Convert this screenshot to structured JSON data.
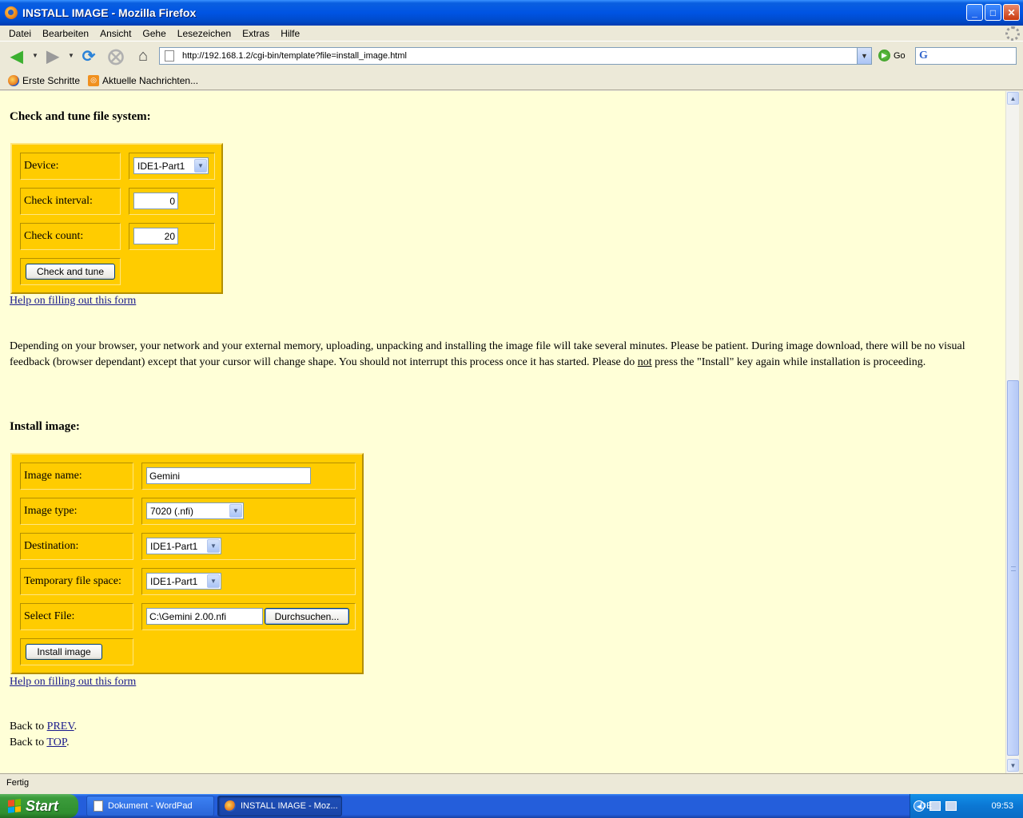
{
  "window": {
    "title": "INSTALL IMAGE - Mozilla Firefox",
    "controls": {
      "minimize": "_",
      "maximize": "□",
      "close": "✕"
    }
  },
  "menu": [
    {
      "label": "Datei"
    },
    {
      "label": "Bearbeiten"
    },
    {
      "label": "Ansicht"
    },
    {
      "label": "Gehe"
    },
    {
      "label": "Lesezeichen"
    },
    {
      "label": "Extras"
    },
    {
      "label": "Hilfe"
    }
  ],
  "toolbar": {
    "url": "http://192.168.1.2/cgi-bin/template?file=install_image.html",
    "go_label": "Go",
    "search_engine_icon": "G",
    "icons": {
      "back": "back-arrow-icon",
      "forward": "forward-arrow-icon",
      "reload": "reload-icon",
      "stop": "stop-icon",
      "home": "home-icon"
    }
  },
  "bookmarks": [
    {
      "label": "Erste Schritte",
      "icon": "firefox-icon"
    },
    {
      "label": "Aktuelle Nachrichten...",
      "icon": "rss-feed-icon"
    }
  ],
  "page": {
    "check_section": {
      "heading": "Check and tune file system:",
      "device_label": "Device:",
      "device_value": "IDE1-Part1",
      "interval_label": "Check interval:",
      "interval_value": "0",
      "count_label": "Check count:",
      "count_value": "20",
      "button": "Check and tune",
      "help_link": "Help on filling out this form"
    },
    "notice": {
      "line1": "Depending on your browser, your network and your external memory, uploading, unpacking and installing the image file will take several minutes.  Please be patient.  During image download, there will be no visual feedback (browser dependant) except that your cursor will change shape.  You should not interrupt this process once it has started.  Please do ",
      "emphasis": "not",
      "line2": " press the \"Install\" key again while installation is proceeding."
    },
    "install_section": {
      "heading": "Install image:",
      "name_label": "Image name:",
      "name_value": "Gemini",
      "type_label": "Image type:",
      "type_value": "7020 (.nfi)",
      "dest_label": "Destination:",
      "dest_value": "IDE1-Part1",
      "temp_label": "Temporary file space:",
      "temp_value": "IDE1-Part1",
      "file_label": "Select File:",
      "file_value": "C:\\Gemini 2.00.nfi",
      "browse_button": "Durchsuchen...",
      "button": "Install image",
      "help_link": "Help on filling out this form"
    },
    "nav": {
      "back_text": "Back to ",
      "prev_link": "PREV",
      "top_link": "TOP",
      "period": "."
    }
  },
  "status": "Fertig",
  "taskbar": {
    "start": "Start",
    "tasks": [
      {
        "label": "Dokument - WordPad",
        "active": false
      },
      {
        "label": "INSTALL IMAGE - Moz...",
        "active": true
      }
    ],
    "language": "DE",
    "clock": "09:53"
  },
  "colors": {
    "page_bg": "#ffffd7",
    "form_bg": "#ffcc00",
    "link": "#1a1a8c"
  }
}
